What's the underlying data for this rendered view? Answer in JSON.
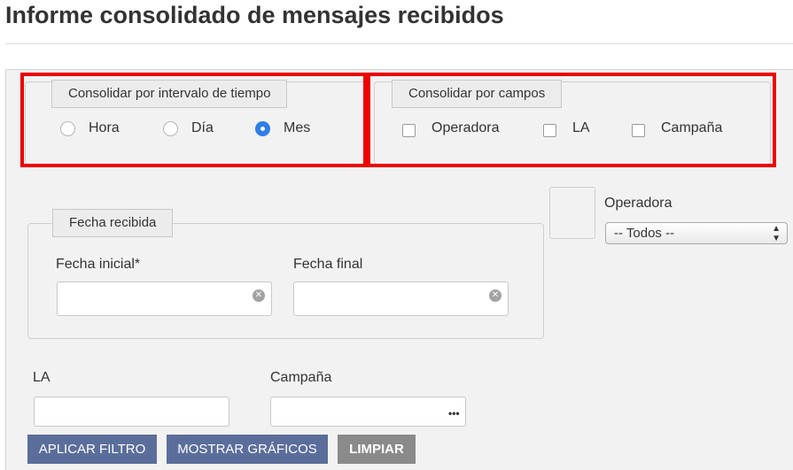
{
  "page": {
    "title": "Informe consolidado de mensajes recibidos"
  },
  "time_interval": {
    "legend": "Consolidar por intervalo de tiempo",
    "options": [
      {
        "label": "Hora",
        "checked": false
      },
      {
        "label": "Día",
        "checked": false
      },
      {
        "label": "Mes",
        "checked": true
      }
    ]
  },
  "fields": {
    "legend": "Consolidar por campos",
    "options": [
      {
        "label": "Operadora",
        "checked": false
      },
      {
        "label": "LA",
        "checked": false
      },
      {
        "label": "Campaña",
        "checked": false
      }
    ]
  },
  "date_received": {
    "legend": "Fecha recibida",
    "start_label": "Fecha inicial*",
    "start_value": "",
    "end_label": "Fecha final",
    "end_value": ""
  },
  "operator": {
    "label": "Operadora",
    "selected": "-- Todos --"
  },
  "la": {
    "label": "LA",
    "value": ""
  },
  "campaign": {
    "label": "Campaña",
    "value": ""
  },
  "buttons": {
    "apply": "APLICAR FILTRO",
    "charts": "MOSTRAR GRÁFICOS",
    "clear": "LIMPIAR"
  },
  "colors": {
    "highlight": "#ee0000",
    "primary_button": "#5b6d9b",
    "secondary_button": "#8a8a8a",
    "radio_checked": "#2f7fe6"
  }
}
